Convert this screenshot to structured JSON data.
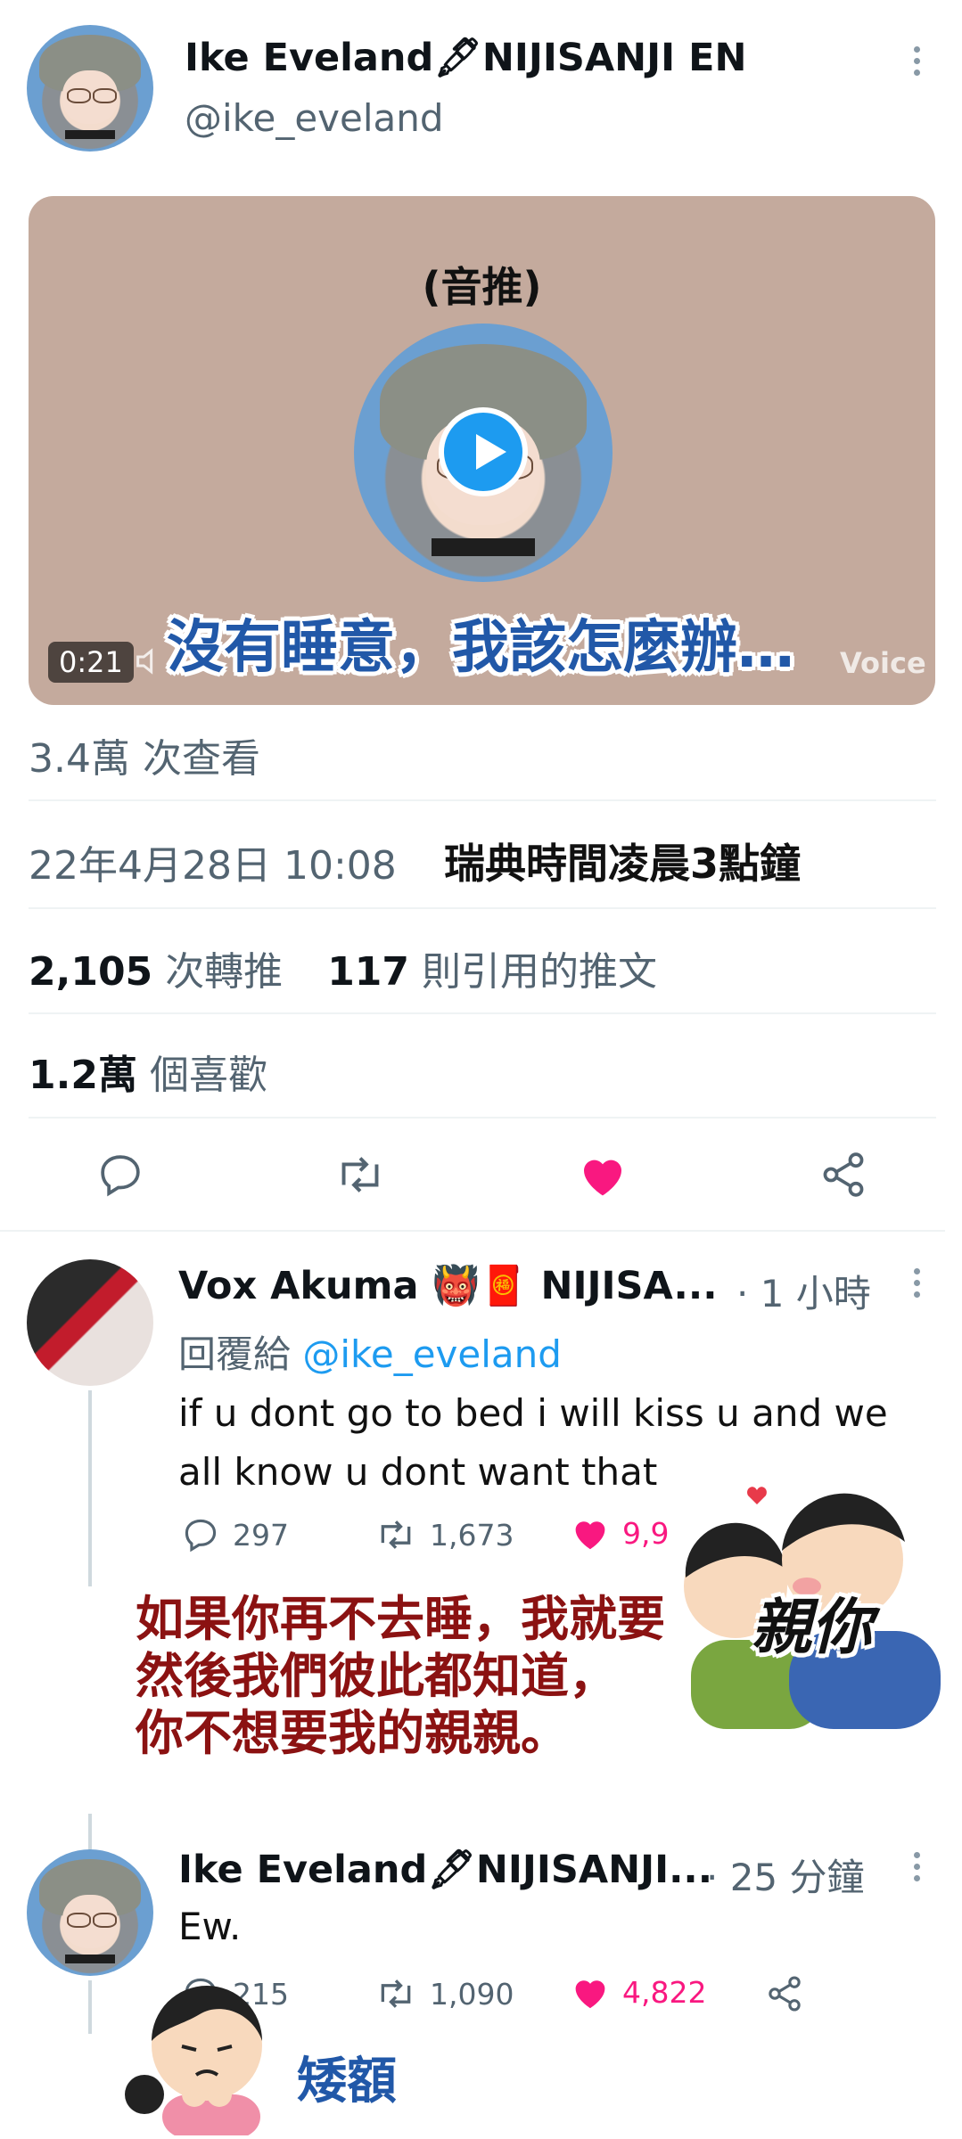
{
  "tweet": {
    "author_name": "Ike Eveland🖋NIJISANJI EN",
    "author_handle": "@ike_eveland",
    "media": {
      "top_label": "(音推)",
      "duration": "0:21",
      "caption": "沒有睡意，我該怎麼辦…",
      "watermark": "Voice"
    },
    "views": "3.4萬 次查看",
    "date": "22年4月28日 10:08",
    "date_note": "瑞典時間凌晨3點鐘",
    "retweets_count": "2,105",
    "retweets_label": "次轉推",
    "quotes_count": "117",
    "quotes_label": "則引用的推文",
    "likes_count": "1.2萬",
    "likes_label": "個喜歡"
  },
  "replies": [
    {
      "author_name": "Vox Akuma 👹🧧 NIJISA...",
      "time": "· 1 小時",
      "reply_prefix": "回覆給",
      "reply_to": "@ike_eveland",
      "text_line1": "if u dont go to bed i will kiss u and we",
      "text_line2": "all know u dont want that",
      "replies": "297",
      "retweets": "1,673",
      "likes": "9,9"
    },
    {
      "author_name": "Ike Eveland🖋NIJISANJI...",
      "time": "· 25 分鐘",
      "text": "Ew.",
      "replies": "215",
      "retweets": "1,090",
      "likes": "4,822"
    }
  ],
  "overlays": {
    "translation_line1": "如果你再不去睡，我就要",
    "translation_kiss": "親你",
    "translation_line2": "然後我們彼此都知道，",
    "translation_line3": "你不想要我的親親。",
    "ew_translation": "矮額"
  },
  "colors": {
    "accent_blue": "#1d9bf0",
    "like_pink": "#f91880",
    "text_grey": "#536471",
    "caption_red": "#8b1212",
    "caption_blue": "#2158a8",
    "media_bg": "#c4aa9d"
  }
}
